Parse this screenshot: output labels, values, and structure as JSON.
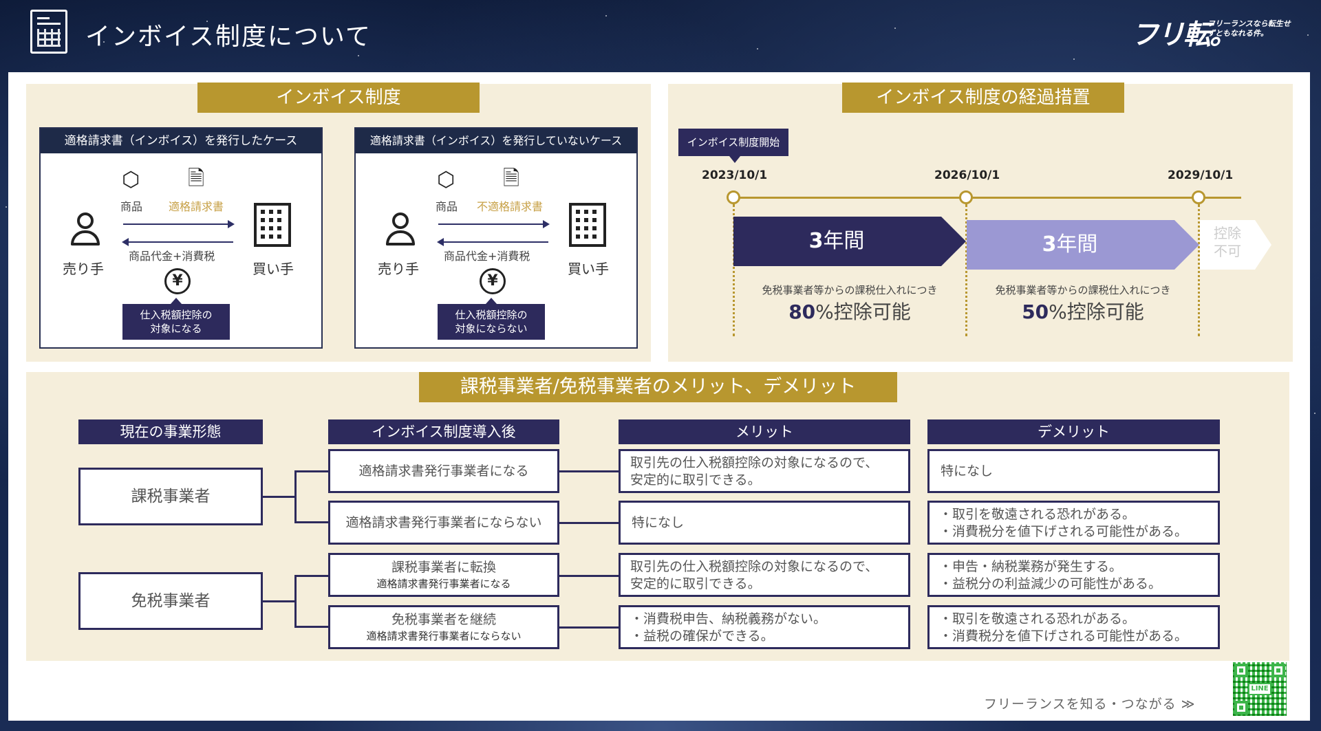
{
  "header": {
    "title": "インボイス制度について",
    "logo": "フリ転。",
    "tagline": "フリーランスなら転生せずともなれる件。"
  },
  "invoice_system": {
    "title": "インボイス制度",
    "cards": [
      {
        "heading": "適格請求書（インボイス）を発行したケース",
        "product": "商品",
        "document": "適格請求書",
        "payment": "商品代金+消費税",
        "seller": "売り手",
        "buyer": "買い手",
        "note_line1": "仕入税額控除の",
        "note_line2": "対象になる"
      },
      {
        "heading": "適格請求書（インボイス）を発行していないケース",
        "product": "商品",
        "document": "不適格請求書",
        "payment": "商品代金+消費税",
        "seller": "売り手",
        "buyer": "買い手",
        "note_line1": "仕入税額控除の",
        "note_line2": "対象にならない"
      }
    ]
  },
  "transition": {
    "title": "インボイス制度の経過措置",
    "start_tag": "インボイス制度開始",
    "dates": [
      "2023/10/1",
      "2026/10/1",
      "2029/10/1"
    ],
    "periods": [
      {
        "num": "3",
        "unit": "年間",
        "desc": "免税事業者等からの課税仕入れにつき",
        "percent": "80",
        "percent_suffix": "%控除可能",
        "color": "#2d2a5c"
      },
      {
        "num": "3",
        "unit": "年間",
        "desc": "免税事業者等からの課税仕入れにつき",
        "percent": "50",
        "percent_suffix": "%控除可能",
        "color": "#9b98d3"
      }
    ],
    "after_line1": "控除",
    "after_line2": "不可"
  },
  "merits": {
    "title": "課税事業者/免税事業者のメリット、デメリット",
    "headers": {
      "current": "現在の事業形態",
      "after": "インボイス制度導入後",
      "merit": "メリット",
      "demerit": "デメリット"
    },
    "groups": [
      {
        "current": "課税事業者",
        "rows": [
          {
            "after": "適格請求書発行事業者になる",
            "after_sub": "",
            "merit": [
              "取引先の仕入税額控除の対象になるので、",
              "安定的に取引できる。"
            ],
            "demerit": [
              "特になし",
              ""
            ]
          },
          {
            "after": "適格請求書発行事業者にならない",
            "after_sub": "",
            "merit": [
              "特になし",
              ""
            ],
            "demerit": [
              "・取引を敬遠される恐れがある。",
              "・消費税分を値下げされる可能性がある。"
            ]
          }
        ]
      },
      {
        "current": "免税事業者",
        "rows": [
          {
            "after": "課税事業者に転換",
            "after_sub": "適格請求書発行事業者になる",
            "merit": [
              "取引先の仕入税額控除の対象になるので、",
              "安定的に取引できる。"
            ],
            "demerit": [
              "・申告・納税業務が発生する。",
              "・益税分の利益減少の可能性がある。"
            ]
          },
          {
            "after": "免税事業者を継続",
            "after_sub": "適格請求書発行事業者にならない",
            "merit": [
              "・消費税申告、納税義務がない。",
              "・益税の確保ができる。"
            ],
            "demerit": [
              "・取引を敬遠される恐れがある。",
              "・消費税分を値下げされる可能性がある。"
            ]
          }
        ]
      }
    ]
  },
  "footer": {
    "text": "フリーランスを知る・つながる ≫",
    "qr_label": "LINE"
  }
}
